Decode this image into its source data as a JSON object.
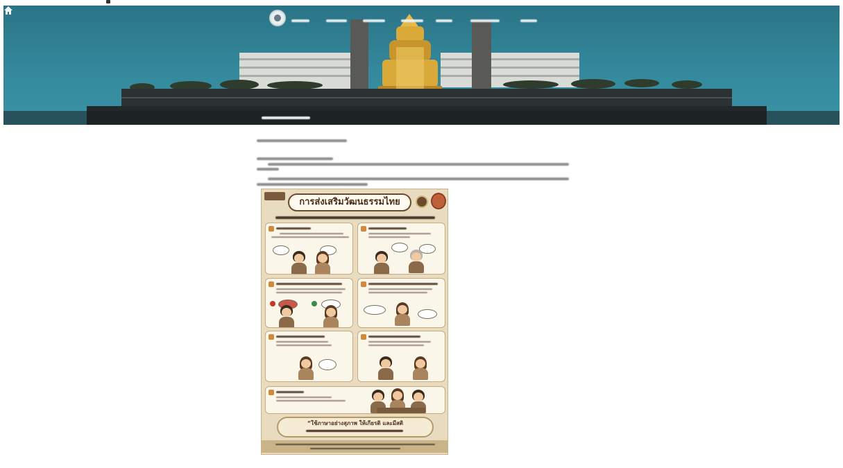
{
  "header": {
    "logo_icon": "seal-logo-icon",
    "home_icon": "home-icon"
  },
  "infographic": {
    "title": "การส่งเสริมวัฒนธรรมไทย",
    "quote_line1": "“ใช้ภาษาอย่างสุภาพ ให้เกียรติ และมีสติ"
  },
  "colors": {
    "banner_sky": "#34899c",
    "infographic_background": "#e8dbc0",
    "infographic_accent": "#6b4b2e",
    "temple_gold": "#d9a93a"
  }
}
